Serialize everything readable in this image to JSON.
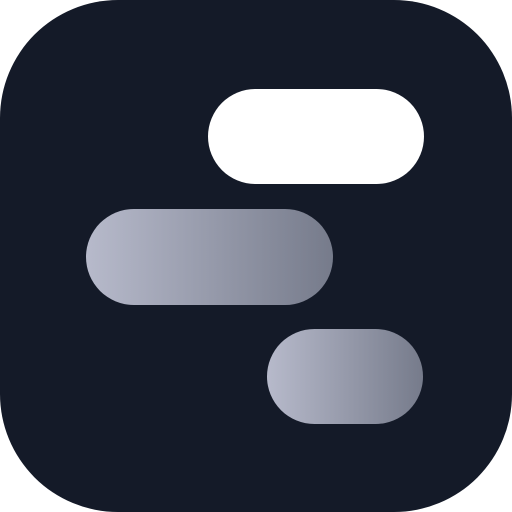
{
  "icon": {
    "name": "gantt-timeline-app-icon",
    "colors": {
      "tile_background": "#141a28",
      "bar_top": "#ffffff",
      "bar_gradient_start": "#b7bacb",
      "bar_gradient_end": "#767b8b"
    },
    "bars": [
      {
        "name": "top-bar",
        "fill": "solid"
      },
      {
        "name": "middle-bar",
        "fill": "gradient"
      },
      {
        "name": "bottom-bar",
        "fill": "gradient"
      }
    ]
  }
}
